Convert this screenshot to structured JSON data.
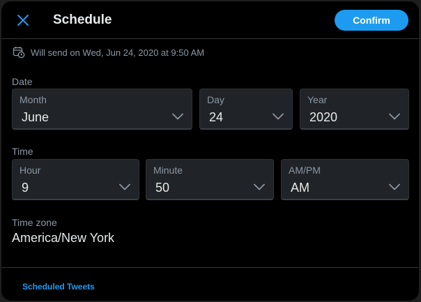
{
  "header": {
    "title": "Schedule",
    "confirm_label": "Confirm"
  },
  "send_info": "Will send on Wed, Jun 24, 2020 at 9:50 AM",
  "date": {
    "section_label": "Date",
    "month": {
      "label": "Month",
      "value": "June"
    },
    "day": {
      "label": "Day",
      "value": "24"
    },
    "year": {
      "label": "Year",
      "value": "2020"
    }
  },
  "time": {
    "section_label": "Time",
    "hour": {
      "label": "Hour",
      "value": "9"
    },
    "minute": {
      "label": "Minute",
      "value": "50"
    },
    "ampm": {
      "label": "AM/PM",
      "value": "AM"
    }
  },
  "timezone": {
    "label": "Time zone",
    "value": "America/New York"
  },
  "footer": {
    "link_label": "Scheduled Tweets"
  },
  "icons": {
    "close": "close-icon",
    "calendar": "calendar-clock-icon",
    "chevron": "chevron-down-icon"
  },
  "colors": {
    "accent": "#1d9bf0",
    "background": "#000000",
    "field": "#202327",
    "muted_text": "#8b98a5"
  }
}
